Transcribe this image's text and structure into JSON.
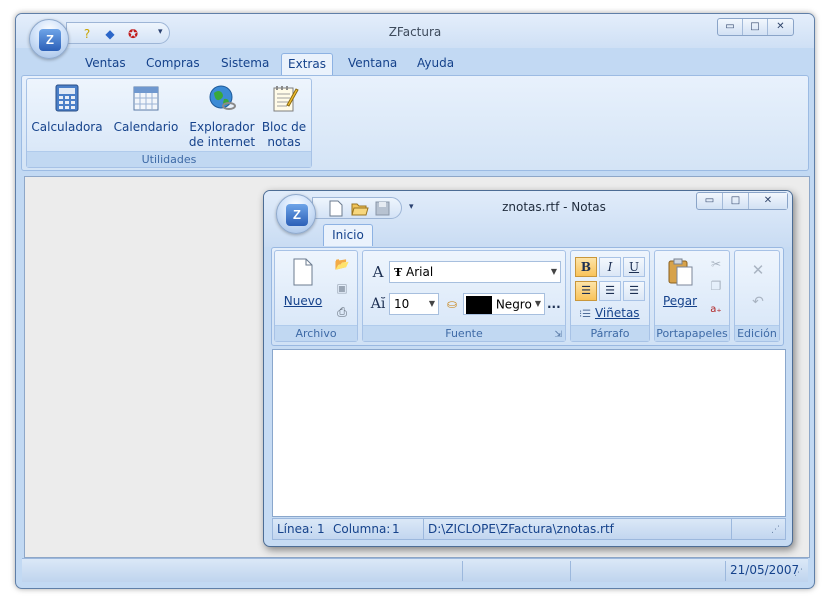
{
  "main_window": {
    "title": "ZFactura",
    "orb_letter": "Z",
    "qat_icons": [
      "help-icon",
      "diamond-icon",
      "ribbon-award-icon",
      "customize-qat-icon"
    ],
    "controls": {
      "minimize": "▭",
      "maximize": "□",
      "close": "✕"
    },
    "tabs": [
      {
        "label": "Ventas"
      },
      {
        "label": "Compras"
      },
      {
        "label": "Sistema"
      },
      {
        "label": "Extras",
        "active": true
      },
      {
        "label": "Ventana"
      },
      {
        "label": "Ayuda"
      }
    ],
    "ribbon": {
      "group_label": "Utilidades",
      "buttons": [
        {
          "label": "Calculadora",
          "icon": "calculator-icon"
        },
        {
          "label": "Calendario",
          "icon": "calendar-icon"
        },
        {
          "label": "Explorador\nde internet",
          "icon": "internet-explorer-icon"
        },
        {
          "label": "Bloc de\nnotas",
          "icon": "notepad-icon"
        }
      ]
    },
    "status": {
      "date": "21/05/2007"
    }
  },
  "notes_window": {
    "title": "znotas.rtf - Notas",
    "orb_letter": "Z",
    "qat_icons": [
      "new-file-icon",
      "open-folder-icon",
      "save-icon",
      "customize-qat-icon"
    ],
    "tab": "Inicio",
    "groups": {
      "archivo": {
        "label": "Archivo",
        "nuevo": "Nuevo"
      },
      "fuente": {
        "label": "Fuente",
        "font_name": "Arial",
        "font_size": "10",
        "color_name": "Negro",
        "more": "..."
      },
      "parrafo": {
        "label": "Párrafo",
        "bold": "B",
        "italic": "I",
        "underline": "U",
        "vinetas": "Viñetas"
      },
      "portapapeles": {
        "label": "Portapapeles",
        "pegar": "Pegar"
      },
      "edicion": {
        "label": "Edición"
      }
    },
    "status": {
      "linea_label": "Línea:",
      "linea_value": "1",
      "columna_label": "Columna:",
      "columna_value": "1",
      "path": "D:\\ZICLOPE\\ZFactura\\znotas.rtf"
    }
  },
  "colors": {
    "accent": "#15428b",
    "ribbon_bg": "#d4e4f6",
    "highlight": "#f9c35a",
    "swatch": "#000000"
  }
}
